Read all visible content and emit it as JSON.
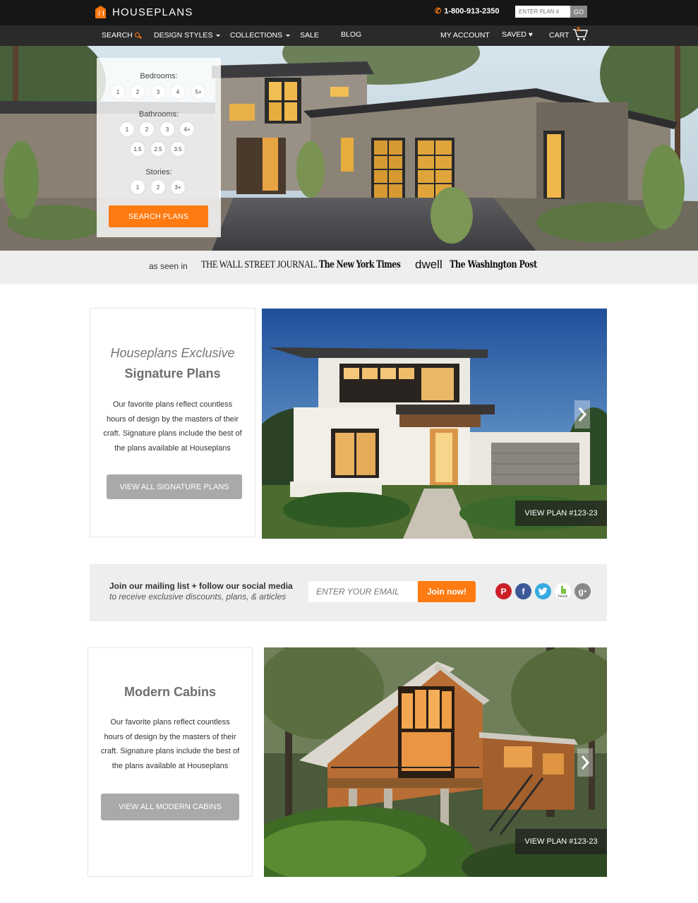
{
  "header": {
    "brand": "HOUSEPLANS",
    "phone": "1-800-913-2350",
    "plan_search_placeholder": "ENTER PLAN #",
    "go_label": "GO",
    "accent": "#ff7a10"
  },
  "nav": {
    "search": "SEARCH",
    "design_styles": "DESIGN STYLES",
    "collections": "COLLECTIONS",
    "sale": "SALE",
    "blog": "BLOG",
    "my_account": "MY ACCOUNT",
    "saved": "SAVED",
    "cart": "CART",
    "cart_count": "0"
  },
  "hero_search": {
    "bedrooms_label": "Bedrooms:",
    "bedrooms": [
      "1",
      "2",
      "3",
      "4",
      "5+"
    ],
    "bathrooms_label": "Bathrooms:",
    "bathrooms_row1": [
      "1",
      "2",
      "3",
      "4+"
    ],
    "bathrooms_row2": [
      "1.5",
      "2.5",
      "3.5"
    ],
    "stories_label": "Stories:",
    "stories": [
      "1",
      "2",
      "3+"
    ],
    "button": "SEARCH PLANS"
  },
  "press": {
    "label": "as seen in",
    "outlets": [
      "THE WALL STREET JOURNAL.",
      "The New York Times",
      "dwell",
      "The Washington Post"
    ]
  },
  "signature": {
    "subtitle": "Houseplans Exclusive",
    "title": "Signature Plans",
    "body_lines": [
      "Our favorite plans reflect countless",
      "hours of design by the masters of their",
      "craft. Signature plans include the best of",
      "the plans available at Houseplans"
    ],
    "button": "VIEW ALL SIGNATURE PLANS",
    "plan_tag": "VIEW PLAN #123-23"
  },
  "mailing": {
    "headline": "Join our mailing list + follow our social media",
    "subline": "to receive exclusive discounts, plans, & articles",
    "email_placeholder": "ENTER YOUR EMAIL",
    "button": "Join now!",
    "social": [
      "pinterest",
      "facebook",
      "twitter",
      "houzz",
      "google-plus"
    ],
    "houzz_label": "houzz"
  },
  "cabins": {
    "title": "Modern Cabins",
    "body_lines": [
      "Our favorite plans reflect countless",
      "hours of design by the masters of their",
      "craft. Signature plans include the best of",
      "the plans available at Houseplans"
    ],
    "button": "VIEW ALL MODERN CABINS",
    "plan_tag": "VIEW PLAN #123-23"
  }
}
